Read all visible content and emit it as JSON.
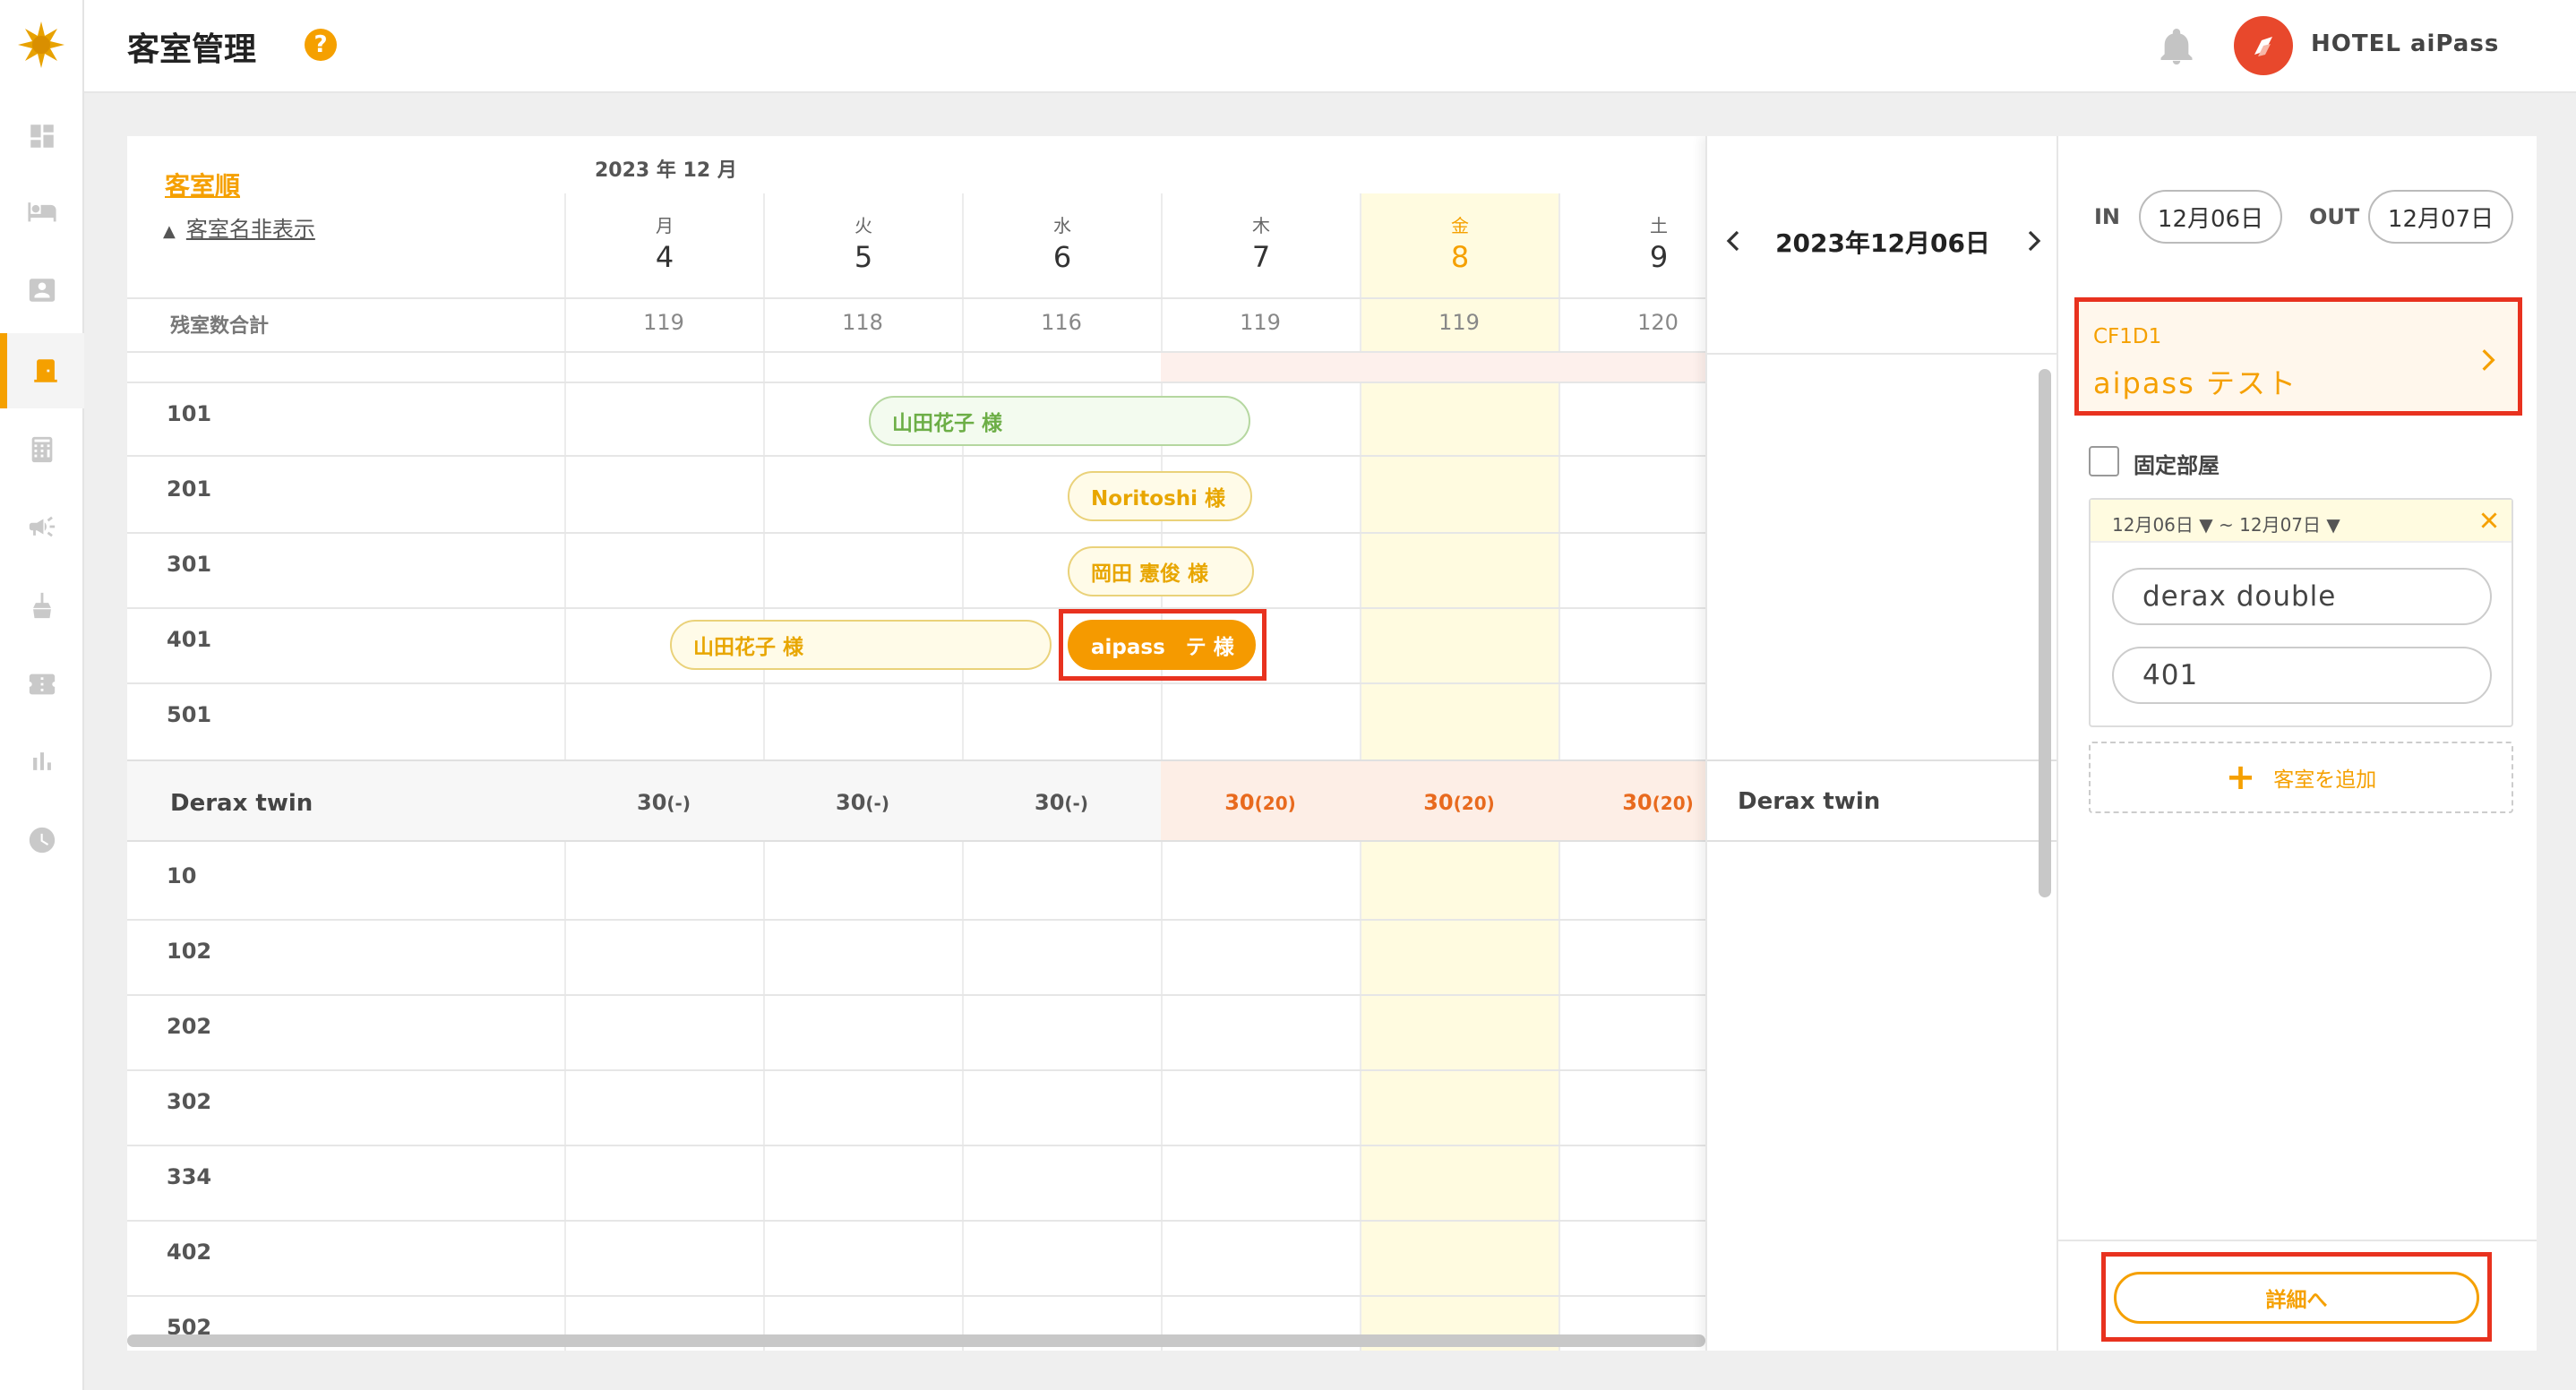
{
  "header": {
    "title": "客室管理",
    "help": "?",
    "hotel_name": "HOTEL aiPass"
  },
  "sidebar": {
    "items": [
      "dashboard-icon",
      "bed-icon",
      "contact-icon",
      "door-icon",
      "calculator-icon",
      "megaphone-icon",
      "cleaning-icon",
      "ticket-icon",
      "chart-icon",
      "clock-icon"
    ],
    "active_index": 3
  },
  "calendar": {
    "sort_label": "客室順",
    "hide_name_label": "客室名非表示",
    "month": "2023 年 12 月",
    "days": [
      {
        "dow": "月",
        "num": "4",
        "remaining": "119"
      },
      {
        "dow": "火",
        "num": "5",
        "remaining": "118"
      },
      {
        "dow": "水",
        "num": "6",
        "remaining": "116"
      },
      {
        "dow": "木",
        "num": "7",
        "remaining": "119"
      },
      {
        "dow": "金",
        "num": "8",
        "remaining": "119"
      },
      {
        "dow": "土",
        "num": "9",
        "remaining": "120"
      }
    ],
    "total_label": "残室数合計",
    "rooms_group1": [
      "101",
      "201",
      "301",
      "401",
      "501"
    ],
    "bookings": [
      {
        "guest": "山田花子 様"
      },
      {
        "guest": "Noritoshi 様"
      },
      {
        "guest": "岡田 憲俊 様"
      },
      {
        "guest": "山田花子 様"
      },
      {
        "guest": "aipass　テ 様"
      }
    ],
    "room_type": {
      "name": "Derax twin",
      "values": [
        {
          "v": "30",
          "s": "(-)"
        },
        {
          "v": "30",
          "s": "(-)"
        },
        {
          "v": "30",
          "s": "(-)"
        },
        {
          "v": "30",
          "s": "(20)"
        },
        {
          "v": "30",
          "s": "(20)"
        },
        {
          "v": "30",
          "s": "(20)"
        }
      ]
    },
    "rooms_group2": [
      "10",
      "102",
      "202",
      "302",
      "334",
      "402",
      "502"
    ]
  },
  "datenav": {
    "date": "2023年12月06日",
    "type_name": "Derax twin"
  },
  "detail": {
    "in_label": "IN",
    "in_date": "12月06日",
    "out_label": "OUT",
    "out_date": "12月07日",
    "res_code": "CF1D1",
    "res_name": "aipass テスト",
    "fixed_room_label": "固定部屋",
    "range_from": "12月06日 ▼",
    "range_sep": "~",
    "range_to": "12月07日 ▼",
    "room_type": "derax double",
    "room_number": "401",
    "add_room_label": "客室を追加",
    "detail_button": "詳細へ"
  }
}
